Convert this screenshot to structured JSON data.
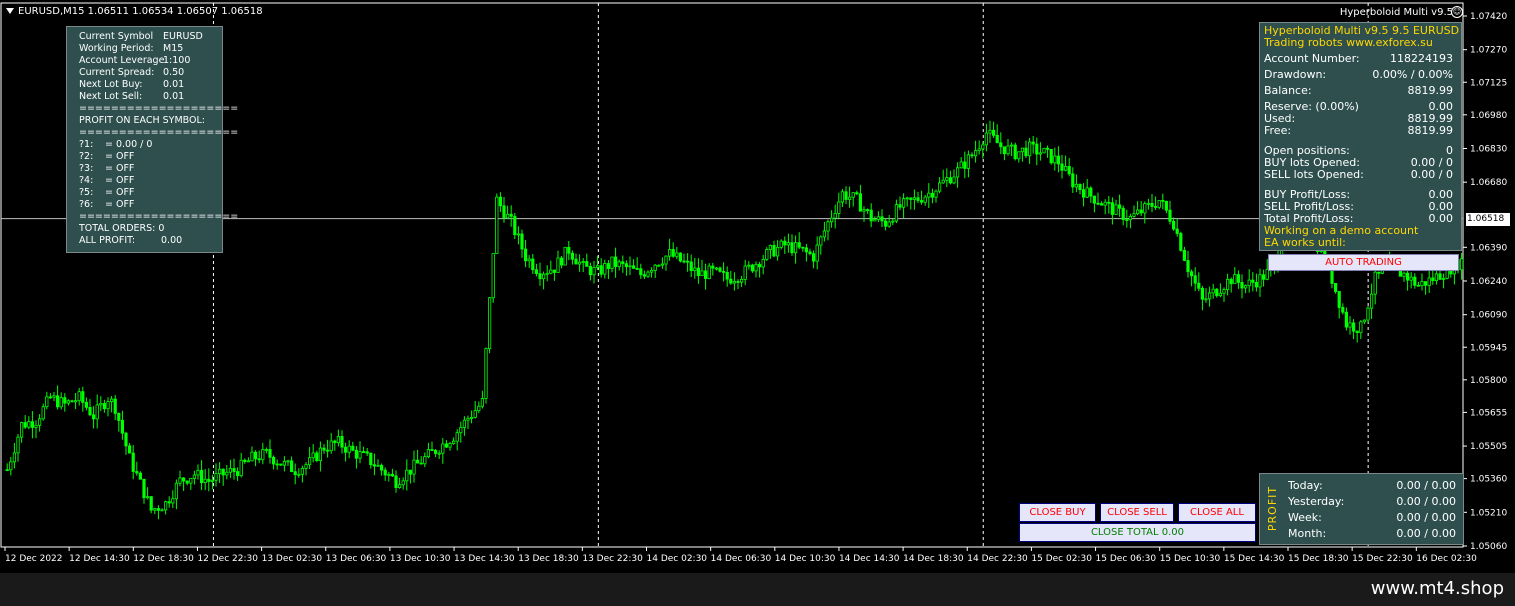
{
  "chart": {
    "symbol": "EURUSD",
    "timeframe": "M15",
    "title": "EURUSD,M15  1.06511 1.06534 1.06507 1.06518",
    "ea_name": "Hyperboloid Multi v9.5",
    "smiley": "☺",
    "current_price_label": "1.06518",
    "current_price": 1.06518,
    "colors": {
      "background": "#000000",
      "candle": "#00ff00",
      "grid": "#ffffff",
      "text": "#ffffff",
      "panel": "#2f4f4f",
      "gold": "#ffd700",
      "button_text_red": "#ff0000",
      "button_text_green": "#008000"
    }
  },
  "chart_data": {
    "type": "candlestick",
    "ylim": [
      1.05,
      1.075
    ],
    "y_ticks": [
      "1.07420",
      "1.07270",
      "1.07125",
      "1.06980",
      "1.06830",
      "1.06680",
      "1.06390",
      "1.06240",
      "1.06090",
      "1.05945",
      "1.05800",
      "1.05655",
      "1.05505",
      "1.05360",
      "1.05210",
      "1.05060"
    ],
    "x_ticks": [
      "12 Dec 2022",
      "12 Dec 14:30",
      "12 Dec 18:30",
      "12 Dec 22:30",
      "13 Dec 02:30",
      "13 Dec 06:30",
      "13 Dec 10:30",
      "13 Dec 14:30",
      "13 Dec 18:30",
      "13 Dec 22:30",
      "14 Dec 02:30",
      "14 Dec 06:30",
      "14 Dec 10:30",
      "14 Dec 14:30",
      "14 Dec 18:30",
      "14 Dec 22:30",
      "15 Dec 02:30",
      "15 Dec 06:30",
      "15 Dec 10:30",
      "15 Dec 14:30",
      "15 Dec 18:30",
      "15 Dec 22:30",
      "16 Dec 02:30"
    ],
    "session_separators": [
      "12 Dec 22:30",
      "13 Dec 22:30",
      "14 Dec 22:30",
      "15 Dec 22:30"
    ],
    "price_path": [
      [
        0,
        1.054
      ],
      [
        4,
        1.056
      ],
      [
        8,
        1.0562
      ],
      [
        12,
        1.0572
      ],
      [
        16,
        1.0569
      ],
      [
        20,
        1.0572
      ],
      [
        24,
        1.0564
      ],
      [
        28,
        1.0572
      ],
      [
        30,
        1.0568
      ],
      [
        34,
        1.0545
      ],
      [
        38,
        1.053
      ],
      [
        40,
        1.0522
      ],
      [
        44,
        1.0525
      ],
      [
        48,
        1.0535
      ],
      [
        52,
        1.0538
      ],
      [
        56,
        1.0535
      ],
      [
        60,
        1.0538
      ],
      [
        64,
        1.054
      ],
      [
        68,
        1.0545
      ],
      [
        72,
        1.0547
      ],
      [
        76,
        1.0543
      ],
      [
        80,
        1.054
      ],
      [
        84,
        1.0543
      ],
      [
        88,
        1.055
      ],
      [
        92,
        1.0552
      ],
      [
        96,
        1.0548
      ],
      [
        100,
        1.0545
      ],
      [
        104,
        1.054
      ],
      [
        108,
        1.0535
      ],
      [
        112,
        1.054
      ],
      [
        116,
        1.0545
      ],
      [
        120,
        1.055
      ],
      [
        124,
        1.0555
      ],
      [
        128,
        1.0563
      ],
      [
        132,
        1.057
      ],
      [
        136,
        1.066
      ],
      [
        140,
        1.065
      ],
      [
        144,
        1.0635
      ],
      [
        148,
        1.0628
      ],
      [
        152,
        1.063
      ],
      [
        156,
        1.0638
      ],
      [
        160,
        1.063
      ],
      [
        164,
        1.0628
      ],
      [
        168,
        1.0632
      ],
      [
        172,
        1.063
      ],
      [
        176,
        1.0627
      ],
      [
        180,
        1.0632
      ],
      [
        184,
        1.0636
      ],
      [
        188,
        1.0632
      ],
      [
        192,
        1.0627
      ],
      [
        196,
        1.0628
      ],
      [
        200,
        1.0625
      ],
      [
        204,
        1.0627
      ],
      [
        208,
        1.0632
      ],
      [
        212,
        1.0637
      ],
      [
        216,
        1.064
      ],
      [
        220,
        1.0638
      ],
      [
        224,
        1.0635
      ],
      [
        228,
        1.065
      ],
      [
        232,
        1.0663
      ],
      [
        236,
        1.066
      ],
      [
        240,
        1.0652
      ],
      [
        244,
        1.065
      ],
      [
        248,
        1.0657
      ],
      [
        252,
        1.066
      ],
      [
        256,
        1.0663
      ],
      [
        260,
        1.0668
      ],
      [
        264,
        1.0673
      ],
      [
        268,
        1.068
      ],
      [
        272,
        1.069
      ],
      [
        276,
        1.0684
      ],
      [
        280,
        1.0681
      ],
      [
        284,
        1.0683
      ],
      [
        288,
        1.0681
      ],
      [
        292,
        1.0677
      ],
      [
        296,
        1.0668
      ],
      [
        300,
        1.0663
      ],
      [
        304,
        1.0659
      ],
      [
        308,
        1.0655
      ],
      [
        312,
        1.0652
      ],
      [
        316,
        1.0656
      ],
      [
        320,
        1.066
      ],
      [
        324,
        1.065
      ],
      [
        328,
        1.063
      ],
      [
        332,
        1.0615
      ],
      [
        336,
        1.062
      ],
      [
        340,
        1.0625
      ],
      [
        344,
        1.0622
      ],
      [
        348,
        1.0625
      ],
      [
        352,
        1.063
      ],
      [
        354,
        1.0645
      ],
      [
        356,
        1.069
      ],
      [
        358,
        1.071
      ],
      [
        360,
        1.07
      ],
      [
        362,
        1.068
      ],
      [
        364,
        1.064
      ],
      [
        368,
        1.0625
      ],
      [
        372,
        1.0605
      ],
      [
        376,
        1.0603
      ],
      [
        380,
        1.0625
      ],
      [
        384,
        1.063
      ],
      [
        388,
        1.0627
      ],
      [
        392,
        1.0622
      ],
      [
        396,
        1.0625
      ],
      [
        400,
        1.0629
      ],
      [
        404,
        1.0633
      ]
    ]
  },
  "info_panel": {
    "rows": [
      {
        "label": "Current Symbol",
        "value": "EURUSD"
      },
      {
        "label": "Working Period:",
        "value": "M15"
      },
      {
        "label": "Account Leverage:",
        "value": "1:100"
      },
      {
        "label": "Current Spread:",
        "value": "0.50"
      },
      {
        "label": "Next Lot Buy:",
        "value": "0.01"
      },
      {
        "label": "Next Lot Sell:",
        "value": "0.01"
      }
    ],
    "separator1": "====================",
    "profit_header": "PROFIT ON EACH SYMBOL:",
    "separator2": "====================",
    "symbols": [
      {
        "label": "?1:",
        "value": "= 0.00 / 0"
      },
      {
        "label": "?2:",
        "value": "= OFF"
      },
      {
        "label": "?3:",
        "value": "= OFF"
      },
      {
        "label": "?4:",
        "value": "= OFF"
      },
      {
        "label": "?5:",
        "value": "= OFF"
      },
      {
        "label": "?6:",
        "value": "= OFF"
      }
    ],
    "separator3": "====================",
    "total_orders_label": "TOTAL ORDERS:",
    "total_orders_value": "0",
    "all_profit_label": "ALL PROFIT:",
    "all_profit_value": "0.00"
  },
  "stats_panel": {
    "header1": "Hyperboloid Multi v9.5 9.5 EURUSD",
    "header2": "Trading robots www.exforex.su",
    "account_number_label": "Account Number:",
    "account_number": "118224193",
    "drawdown_label": "Drawdown:",
    "drawdown": "0.00% / 0.00%",
    "balance_label": "Balance:",
    "balance": "8819.99",
    "reserve_label": "Reserve: (0.00%)",
    "reserve": "0.00",
    "used_label": "Used:",
    "used": "8819.99",
    "free_label": "Free:",
    "free": "8819.99",
    "open_positions_label": "Open positions:",
    "open_positions": "0",
    "buy_lots_label": "BUY lots Opened:",
    "buy_lots": "0.00 / 0",
    "sell_lots_label": "SELL lots Opened:",
    "sell_lots": "0.00 / 0",
    "buy_pl_label": "BUY Profit/Loss:",
    "buy_pl": "0.00",
    "sell_pl_label": "SELL Profit/Loss:",
    "sell_pl": "0.00",
    "total_pl_label": "Total Profit/Loss:",
    "total_pl": "0.00",
    "demo_notice": "Working on a demo account",
    "works_until": "EA works until:"
  },
  "auto_trading": "AUTO TRADING",
  "buttons": {
    "close_buy": "CLOSE BUY",
    "close_sell": "CLOSE SELL",
    "close_all": "CLOSE ALL",
    "close_total": "CLOSE TOTAL 0.00"
  },
  "profit_panel": {
    "label": "PROFIT",
    "today_label": "Today:",
    "today": "0.00 / 0.00",
    "yesterday_label": "Yesterday:",
    "yesterday": "0.00 / 0.00",
    "week_label": "Week:",
    "week": "0.00 / 0.00",
    "month_label": "Month:",
    "month": "0.00 / 0.00"
  },
  "footer": {
    "watermark": "www.mt4.shop"
  }
}
